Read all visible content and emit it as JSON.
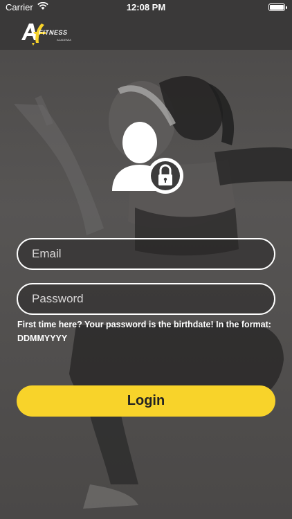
{
  "status_bar": {
    "carrier": "Carrier",
    "time": "12:08 PM",
    "battery_level": 1.0
  },
  "header": {
    "logo_text": "FITNESS",
    "logo_subtext": "ACADEMIA"
  },
  "icons": {
    "wifi": "wifi-icon",
    "battery": "battery-icon",
    "user_lock": "user-lock-icon"
  },
  "form": {
    "email_placeholder": "Email",
    "password_placeholder": "Password",
    "hint": "First time here? Your password is the birthdate! In the format: DDMMYYYY",
    "login_label": "Login"
  },
  "colors": {
    "accent": "#f8d32a",
    "topbar": "#3a3939",
    "field_border": "#ffffff"
  }
}
